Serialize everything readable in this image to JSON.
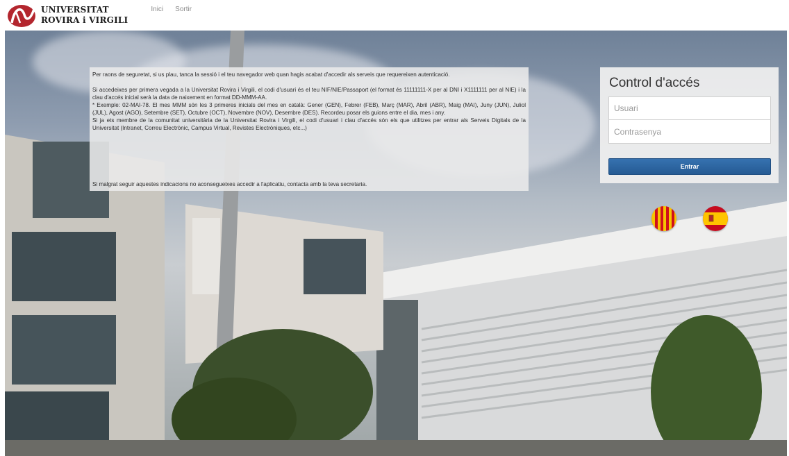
{
  "brand": {
    "line1": "UNIVERSITAT",
    "line2": "ROVIRA i VIRGILI",
    "accent": "#b3262e"
  },
  "nav": {
    "home": "Inici",
    "logout": "Sortir"
  },
  "info": {
    "p1": "Per raons de seguretat, si us plau, tanca la sessió i el teu navegador web quan hagis acabat d'accedir als serveis que requereixen autenticació.",
    "p2": "Si accedeixes per primera vegada a la Universitat Rovira i Virgili, el codi d'usuari és el teu NIF/NIE/Passaport (el format és 11111111-X per al DNI i X1111111 per al NIE) i la clau d'accés inicial serà la data de naixement en format DD-MMM-AA.",
    "p3": "* Exemple: 02-MAI-78. El mes MMM són les 3 primeres inicials del mes en català: Gener (GEN), Febrer (FEB), Març (MAR), Abril (ABR), Maig (MAI), Juny (JUN), Juliol (JUL), Agost (AGO), Setembre (SET), Octubre (OCT), Novembre (NOV), Desembre (DES). Recordeu posar els guions entre el dia, mes i any.",
    "p4": "Si ja ets membre de la comunitat universitària de la Universitat Rovira i Virgili, el codi d'usuari i clau d'accés són els que utilitzes per entrar als Serveis Digitals de la Universitat (Intranet, Correu Electrònic, Campus Virtual, Revistes Electròniques, etc...)",
    "p5": "Si malgrat seguir aquestes indicacions no aconsegueixes accedir a l'aplicatiu, contacta amb la teva secretaria."
  },
  "login": {
    "title": "Control d'accés",
    "user_placeholder": "Usuari",
    "user_value": "",
    "pass_placeholder": "Contrasenya",
    "pass_value": "",
    "submit_label": "Entrar",
    "button_color": "#2d65a3"
  },
  "languages": [
    {
      "code": "ca",
      "icon": "catalan-flag-icon"
    },
    {
      "code": "es",
      "icon": "spanish-flag-icon"
    }
  ]
}
